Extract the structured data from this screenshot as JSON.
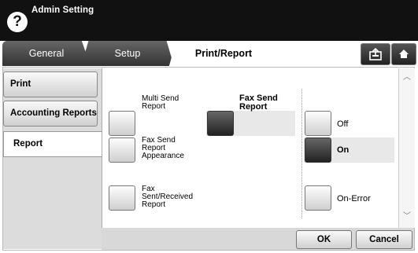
{
  "header": {
    "title": "Admin Setting",
    "help_icon": "?"
  },
  "tabs": {
    "general": "General",
    "setup": "Setup",
    "print_report": "Print/Report"
  },
  "top_buttons": {
    "export_icon": "⇪",
    "home_icon": "⌂"
  },
  "sidebar": {
    "print": "Print",
    "accounting_reports": "Accounting Reports",
    "report": "Report"
  },
  "options": {
    "multi_send_report": [
      "Multi Send",
      "Report"
    ],
    "fax_send_report": [
      "Fax Send",
      "Report"
    ],
    "fax_send_report_appearance": [
      "Fax Send",
      "Report",
      "Appearance"
    ],
    "fax_sent_received_report": [
      "Fax",
      "Sent/Received",
      "Report"
    ],
    "off": "Off",
    "on": "On",
    "on_error": "On-Error"
  },
  "scroll": {
    "up": "︿",
    "down": "﹀"
  },
  "actions": {
    "ok": "OK",
    "cancel": "Cancel"
  }
}
